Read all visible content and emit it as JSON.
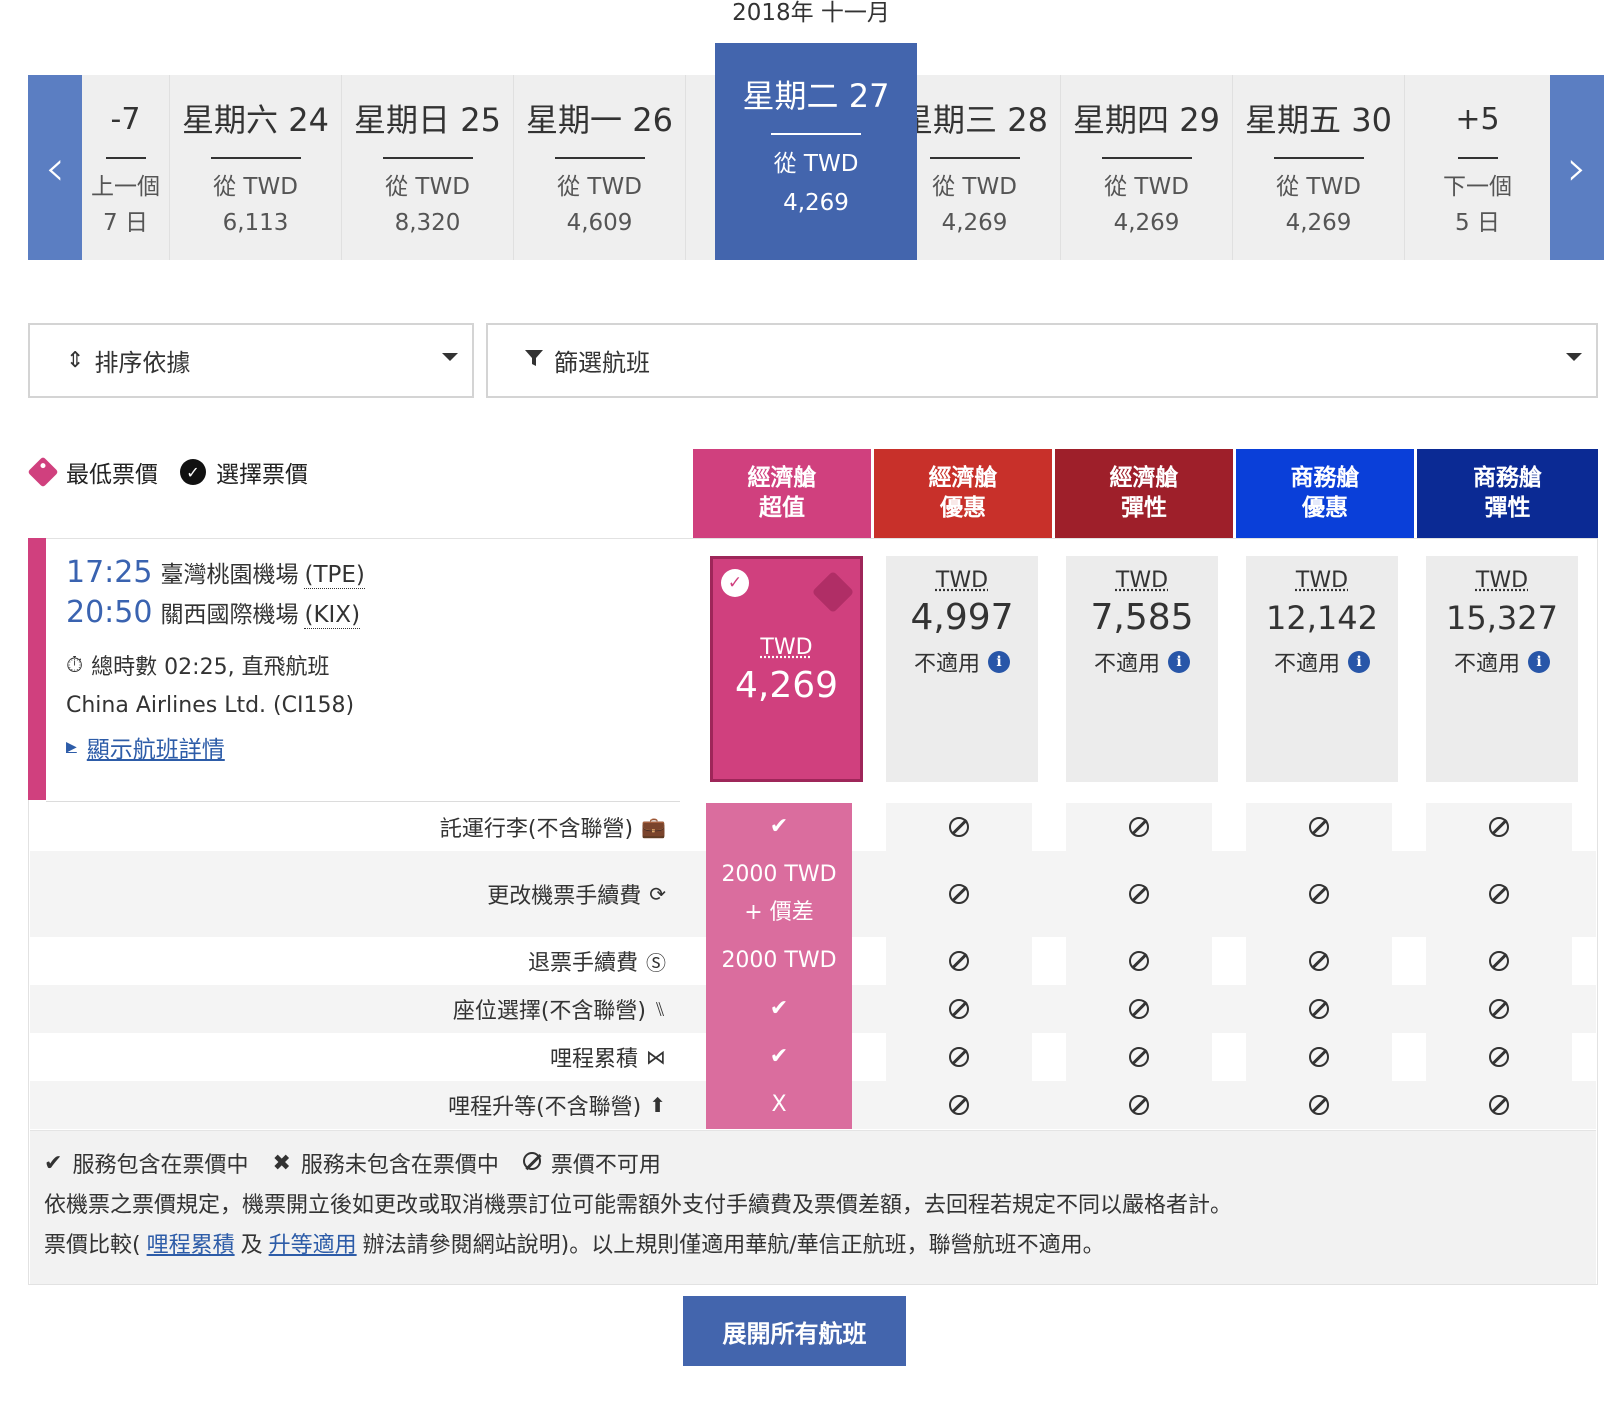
{
  "month": "2018年 十一月",
  "nav": {
    "prev_icon": "‹",
    "next_icon": "›"
  },
  "days": [
    {
      "title": "-7",
      "from": "上一個",
      "price": "7 日"
    },
    {
      "title": "星期六 24",
      "from": "從 TWD",
      "price": "6,113"
    },
    {
      "title": "星期日 25",
      "from": "從 TWD",
      "price": "8,320"
    },
    {
      "title": "星期一 26",
      "from": "從 TWD",
      "price": "4,609"
    },
    {
      "title": "星期二 27",
      "from": "從 TWD",
      "price": "4,269"
    },
    {
      "title": "星期三 28",
      "from": "從 TWD",
      "price": "4,269"
    },
    {
      "title": "星期四 29",
      "from": "從 TWD",
      "price": "4,269"
    },
    {
      "title": "星期五 30",
      "from": "從 TWD",
      "price": "4,269"
    },
    {
      "title": "+5",
      "from": "下一個",
      "price": "5 日"
    }
  ],
  "sort": {
    "label": "排序依據",
    "icon": "sort-icon"
  },
  "filter": {
    "label": "篩選航班",
    "icon": "filter-icon"
  },
  "legend_top": {
    "lowest": "最低票價",
    "selected": "選擇票價"
  },
  "fares": [
    {
      "line1": "經濟艙",
      "line2": "超值",
      "color": "#d0407e"
    },
    {
      "line1": "經濟艙",
      "line2": "優惠",
      "color": "#c8302a"
    },
    {
      "line1": "經濟艙",
      "line2": "彈性",
      "color": "#9e1f2a"
    },
    {
      "line1": "商務艙",
      "line2": "優惠",
      "color": "#0a3fd9"
    },
    {
      "line1": "商務艙",
      "line2": "彈性",
      "color": "#0b2a94"
    }
  ],
  "flight": {
    "dep_time": "17:25",
    "dep_airport": "臺灣桃園機場",
    "dep_code": "(TPE)",
    "arr_time": "20:50",
    "arr_airport": "關西國際機場",
    "arr_code": "(KIX)",
    "duration": "總時數 02:25, 直飛航班",
    "carrier": "China Airlines Ltd. (CI158)",
    "details": "顯示航班詳情"
  },
  "fare_prices": [
    {
      "currency": "TWD",
      "amount": "4,269",
      "note": ""
    },
    {
      "currency": "TWD",
      "amount": "4,997",
      "note": "不適用"
    },
    {
      "currency": "TWD",
      "amount": "7,585",
      "note": "不適用"
    },
    {
      "currency": "TWD",
      "amount": "12,142",
      "note": "不適用"
    },
    {
      "currency": "TWD",
      "amount": "15,327",
      "note": "不適用"
    }
  ],
  "features": [
    {
      "label": "託運行李(不含聯營)",
      "icon": "suitcase-icon",
      "selected": "✔"
    },
    {
      "label": "更改機票手續費",
      "icon": "refresh-icon",
      "selected": "2000 TWD + 價差"
    },
    {
      "label": "退票手續費",
      "icon": "refund-icon",
      "selected": "2000 TWD"
    },
    {
      "label": "座位選擇(不含聯營)",
      "icon": "seat-icon",
      "selected": "✔"
    },
    {
      "label": "哩程累積",
      "icon": "miles-icon",
      "selected": "✔"
    },
    {
      "label": "哩程升等(不含聯營)",
      "icon": "upgrade-icon",
      "selected": "X"
    }
  ],
  "notes": {
    "included": "服務包含在票價中",
    "excluded": "服務未包含在票價中",
    "unavailable": "票價不可用",
    "line2": "依機票之票價規定，機票開立後如更改或取消機票訂位可能需額外支付手續費及票價差額，去回程若規定不同以嚴格者計。",
    "line3_a": "票價比較(",
    "link_miles": "哩程累積",
    "line3_b": "及",
    "link_upgrade": "升等適用",
    "line3_c": "辦法請參閱網站說明)。以上規則僅適用華航/華信正航班，聯營航班不適用。"
  },
  "expand_button": "展開所有航班"
}
